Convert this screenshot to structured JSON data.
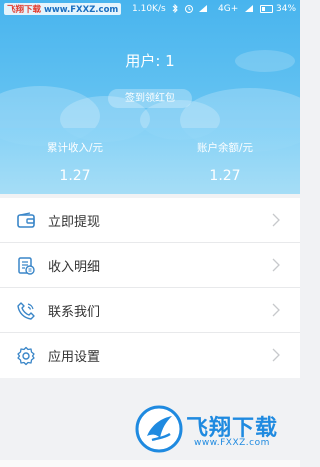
{
  "status_bar": {
    "watermark_prefix": "飞翔下载",
    "watermark_site": "www.FXXZ.com",
    "speed": "1.10K/s",
    "network": "4G+",
    "battery": "34%"
  },
  "header": {
    "user_title": "用户: 1",
    "sign_button_label": "签到领红包"
  },
  "stats": [
    {
      "label": "累计收入/元",
      "value": "1.27"
    },
    {
      "label": "账户余额/元",
      "value": "1.27"
    }
  ],
  "menu": [
    {
      "label": "立即提现",
      "icon": "wallet-icon"
    },
    {
      "label": "收入明细",
      "icon": "income-detail-icon"
    },
    {
      "label": "联系我们",
      "icon": "phone-icon"
    },
    {
      "label": "应用设置",
      "icon": "settings-gear-icon"
    }
  ],
  "watermark": {
    "title": "飞翔下载",
    "url": "www.FXXZ.com"
  },
  "colors": {
    "header_blue": "#48b4ee",
    "icon_blue": "#3a86c8",
    "watermark_blue": "#1f8ae0"
  }
}
